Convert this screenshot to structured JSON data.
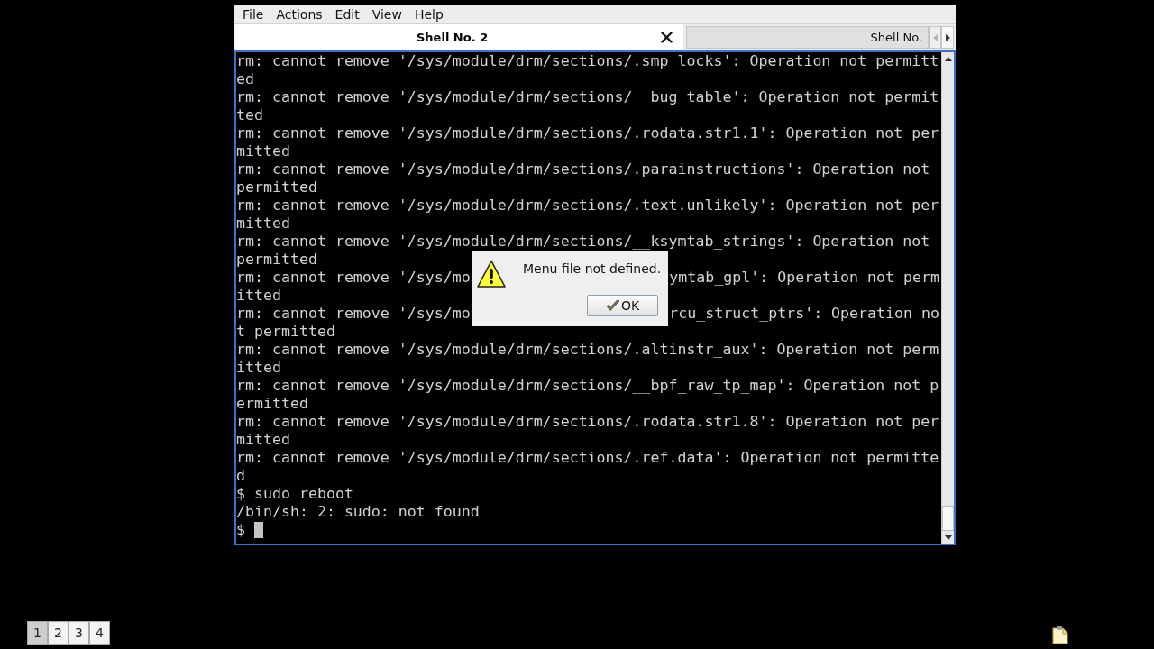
{
  "menu_bar": [
    "File",
    "Actions",
    "Edit",
    "View",
    "Help"
  ],
  "tabs": [
    {
      "label": "Shell No. 2",
      "selected": true
    },
    {
      "label": "Shell No.",
      "selected": false
    }
  ],
  "tab_scroll_buttons": [
    {
      "kind": "left",
      "disabled": true
    },
    {
      "kind": "right",
      "disabled": false
    }
  ],
  "terminal": {
    "lines": [
      {
        "kind": "text",
        "text": "rm: cannot remove '/sys/module/drm/sections/.smp_locks': Operation not permitt"
      },
      {
        "kind": "text",
        "text": "ed"
      },
      {
        "kind": "text",
        "text": "rm: cannot remove '/sys/module/drm/sections/__bug_table': Operation not permit"
      },
      {
        "kind": "text",
        "text": "ted"
      },
      {
        "kind": "text",
        "text": "rm: cannot remove '/sys/module/drm/sections/.rodata.str1.1': Operation not per"
      },
      {
        "kind": "text",
        "text": "mitted"
      },
      {
        "kind": "text",
        "text": "rm: cannot remove '/sys/module/drm/sections/.parainstructions': Operation not"
      },
      {
        "kind": "text",
        "text": "permitted"
      },
      {
        "kind": "text",
        "text": "rm: cannot remove '/sys/module/drm/sections/.text.unlikely': Operation not per"
      },
      {
        "kind": "text",
        "text": "mitted"
      },
      {
        "kind": "text",
        "text": "rm: cannot remove '/sys/module/drm/sections/__ksymtab_strings': Operation not"
      },
      {
        "kind": "text",
        "text": "permitted"
      },
      {
        "kind": "split",
        "left": "rm: cannot remove '/sys/mo",
        "right": "ymtab_gpl': Operation not perm"
      },
      {
        "kind": "text",
        "text": "itted"
      },
      {
        "kind": "split",
        "left": "rm: cannot remove '/sys/mo",
        "right": "rcu_struct_ptrs': Operation no"
      },
      {
        "kind": "text",
        "text": "t permitted"
      },
      {
        "kind": "text",
        "text": "rm: cannot remove '/sys/module/drm/sections/.altinstr_aux': Operation not perm"
      },
      {
        "kind": "text",
        "text": "itted"
      },
      {
        "kind": "text",
        "text": "rm: cannot remove '/sys/module/drm/sections/__bpf_raw_tp_map': Operation not p"
      },
      {
        "kind": "text",
        "text": "ermitted"
      },
      {
        "kind": "text",
        "text": "rm: cannot remove '/sys/module/drm/sections/.rodata.str1.8': Operation not per"
      },
      {
        "kind": "text",
        "text": "mitted"
      },
      {
        "kind": "text",
        "text": "rm: cannot remove '/sys/module/drm/sections/.ref.data': Operation not permitte"
      },
      {
        "kind": "text",
        "text": "d"
      },
      {
        "kind": "text",
        "text": "$ sudo reboot"
      },
      {
        "kind": "text",
        "text": "/bin/sh: 2: sudo: not found"
      },
      {
        "kind": "prompt",
        "text": "$"
      }
    ]
  },
  "dialog": {
    "message": "Menu file not defined.",
    "button": "OK"
  },
  "pager": [
    {
      "label": "1",
      "selected": true
    },
    {
      "label": "2",
      "selected": false
    },
    {
      "label": "3",
      "selected": false
    },
    {
      "label": "4",
      "selected": false
    }
  ]
}
